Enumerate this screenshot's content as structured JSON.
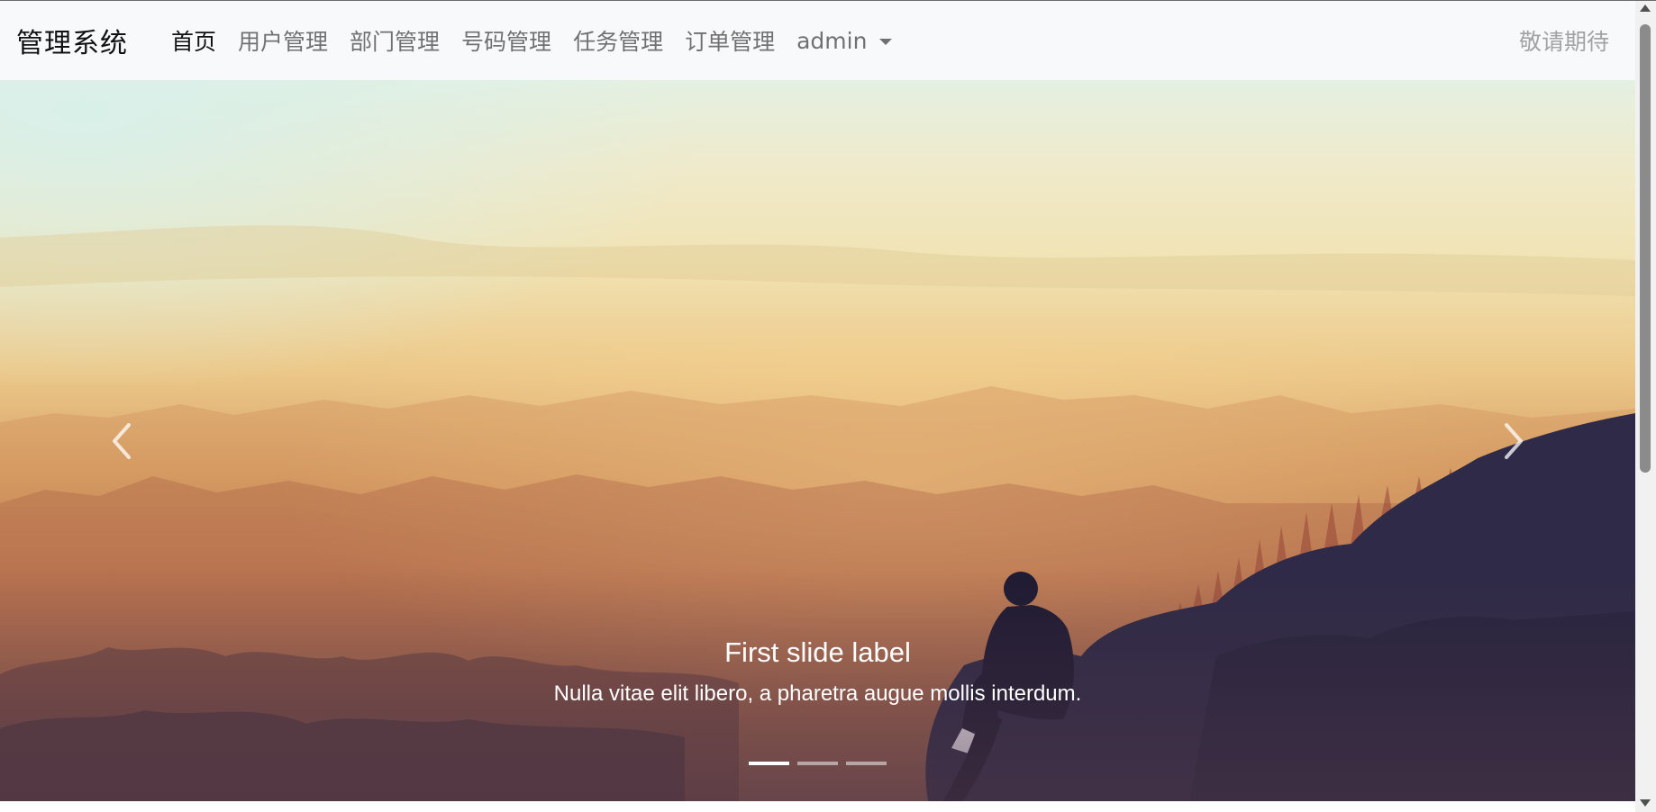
{
  "navbar": {
    "brand": "管理系统",
    "links": [
      {
        "label": "首页",
        "active": true
      },
      {
        "label": "用户管理",
        "active": false
      },
      {
        "label": "部门管理",
        "active": false
      },
      {
        "label": "号码管理",
        "active": false
      },
      {
        "label": "任务管理",
        "active": false
      },
      {
        "label": "订单管理",
        "active": false
      }
    ],
    "dropdown_label": "admin",
    "right_text": "敬请期待"
  },
  "carousel": {
    "caption_title": "First slide label",
    "caption_text": "Nulla vitae elit libero, a pharetra augue mollis interdum.",
    "prev_icon": "chevron-left-icon",
    "next_icon": "chevron-right-icon",
    "indicators": [
      {
        "active": true
      },
      {
        "active": false
      },
      {
        "active": false
      }
    ]
  },
  "colors": {
    "navbar_bg": "#f8f9fa",
    "active_link": "#111111",
    "muted_link": "rgba(0,0,0,0.55)",
    "caption_text": "#ffffff"
  }
}
